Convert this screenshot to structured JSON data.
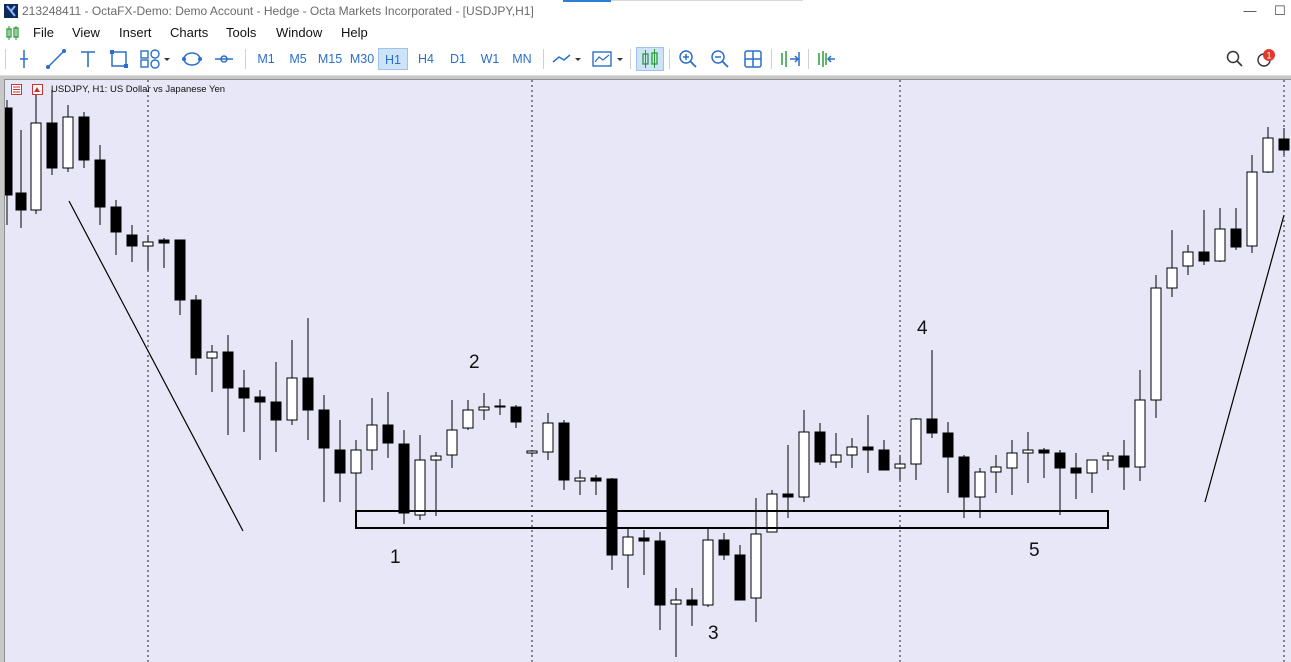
{
  "window": {
    "title": "213248411 - OctaFX-Demo: Demo Account - Hedge - Octa Markets Incorporated - [USDJPY,H1]",
    "controls": [
      "—",
      "☐"
    ]
  },
  "menu": [
    "File",
    "View",
    "Insert",
    "Charts",
    "Tools",
    "Window",
    "Help"
  ],
  "toolbar": {
    "timeframes": [
      "M1",
      "M5",
      "M15",
      "M30",
      "H1",
      "H4",
      "D1",
      "W1",
      "MN"
    ],
    "active_timeframe": "H1",
    "notification_count": "1"
  },
  "chart": {
    "label": "USDJPY, H1:  US Dollar vs Japanese Yen",
    "annotations": [
      "1",
      "2",
      "3",
      "4",
      "5"
    ],
    "colors": {
      "background": "#e7e7f7",
      "bull": "#ffffff",
      "bear": "#000000",
      "accent": "#2a6fc9"
    }
  }
}
